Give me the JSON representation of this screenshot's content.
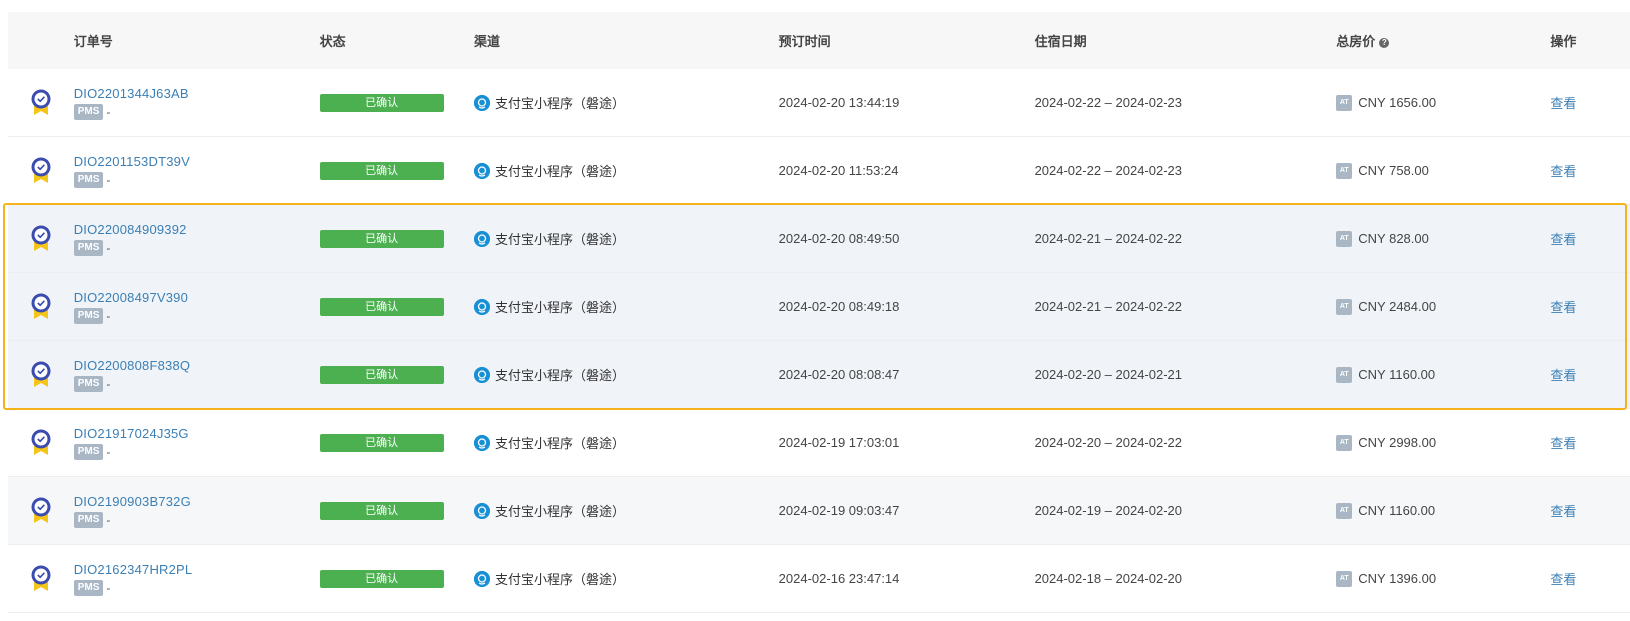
{
  "header": {
    "order_no": "订单号",
    "status": "状态",
    "channel": "渠道",
    "booking_time": "预订时间",
    "stay_date": "住宿日期",
    "total_price": "总房价",
    "action": "操作"
  },
  "pms_label": "PMS",
  "pms_value": "-",
  "at_label": "AT",
  "colors": {
    "status_green": "#4caf50",
    "link_blue": "#3b7fb5",
    "highlight": "#f5b21b"
  },
  "rows": [
    {
      "order_id": "DIO2201344J63AB",
      "status": "已确认",
      "channel": "支付宝小程序（磐途）",
      "booking_time": "2024-02-20 13:44:19",
      "stay": "2024-02-22 – 2024-02-23",
      "price": "CNY 1656.00",
      "action": "查看"
    },
    {
      "order_id": "DIO2201153DT39V",
      "status": "已确认",
      "channel": "支付宝小程序（磐途）",
      "booking_time": "2024-02-20 11:53:24",
      "stay": "2024-02-22 – 2024-02-23",
      "price": "CNY 758.00",
      "action": "查看"
    },
    {
      "order_id": "DIO220084909392",
      "status": "已确认",
      "channel": "支付宝小程序（磐途）",
      "booking_time": "2024-02-20 08:49:50",
      "stay": "2024-02-21 – 2024-02-22",
      "price": "CNY 828.00",
      "action": "查看"
    },
    {
      "order_id": "DIO22008497V390",
      "status": "已确认",
      "channel": "支付宝小程序（磐途）",
      "booking_time": "2024-02-20 08:49:18",
      "stay": "2024-02-21 – 2024-02-22",
      "price": "CNY 2484.00",
      "action": "查看"
    },
    {
      "order_id": "DIO2200808F838Q",
      "status": "已确认",
      "channel": "支付宝小程序（磐途）",
      "booking_time": "2024-02-20 08:08:47",
      "stay": "2024-02-20 – 2024-02-21",
      "price": "CNY 1160.00",
      "action": "查看"
    },
    {
      "order_id": "DIO21917024J35G",
      "status": "已确认",
      "channel": "支付宝小程序（磐途）",
      "booking_time": "2024-02-19 17:03:01",
      "stay": "2024-02-20 – 2024-02-22",
      "price": "CNY 2998.00",
      "action": "查看"
    },
    {
      "order_id": "DIO2190903B732G",
      "status": "已确认",
      "channel": "支付宝小程序（磐途）",
      "booking_time": "2024-02-19 09:03:47",
      "stay": "2024-02-19 – 2024-02-20",
      "price": "CNY 1160.00",
      "action": "查看"
    },
    {
      "order_id": "DIO2162347HR2PL",
      "status": "已确认",
      "channel": "支付宝小程序（磐途）",
      "booking_time": "2024-02-16 23:47:14",
      "stay": "2024-02-18 – 2024-02-20",
      "price": "CNY 1396.00",
      "action": "查看"
    }
  ]
}
